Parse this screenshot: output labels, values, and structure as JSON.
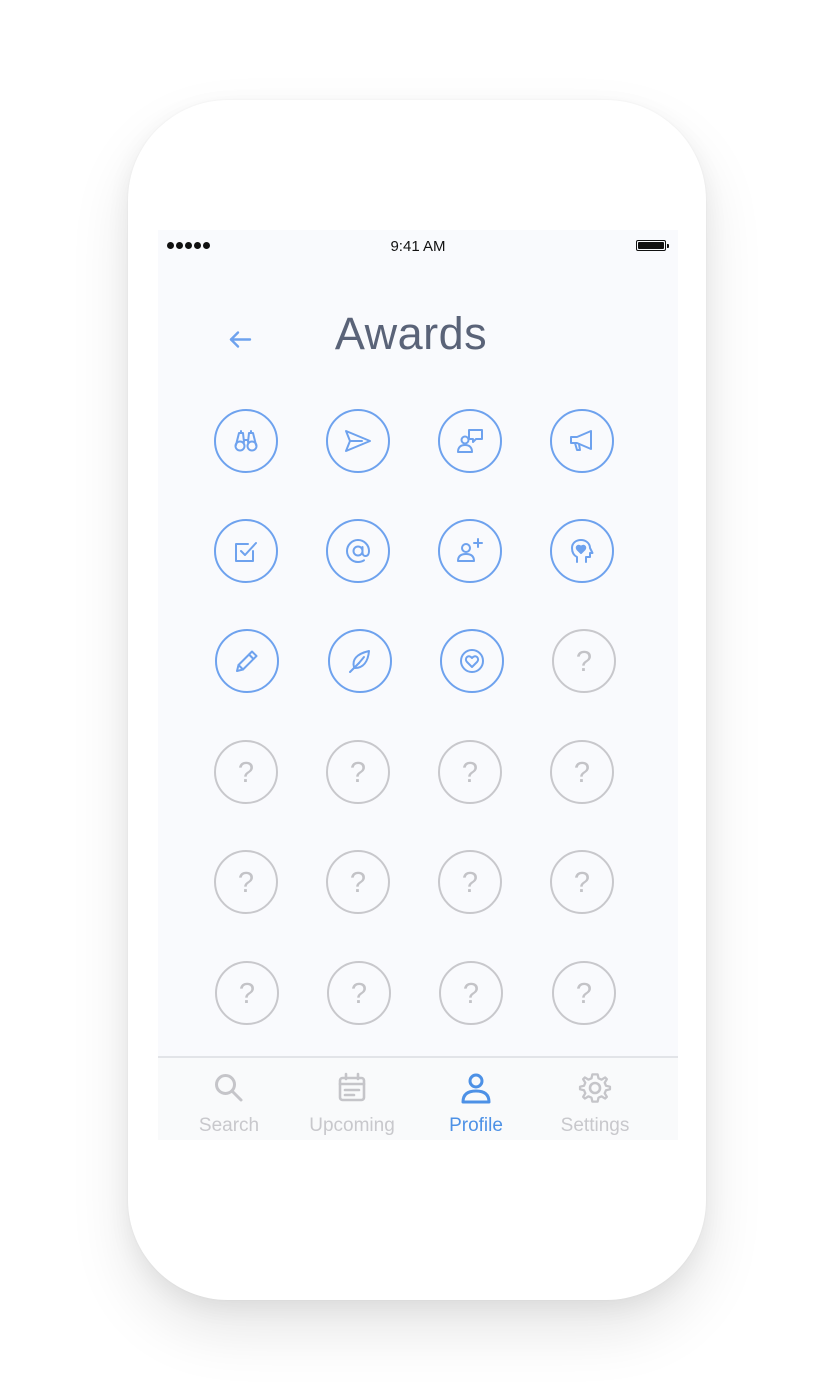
{
  "status_bar": {
    "time": "9:41 AM"
  },
  "header": {
    "title": "Awards",
    "back_icon": "arrow-left-icon"
  },
  "awards": {
    "unlocked": [
      {
        "icon": "binoculars-icon"
      },
      {
        "icon": "paper-plane-icon"
      },
      {
        "icon": "person-speech-icon"
      },
      {
        "icon": "megaphone-icon"
      },
      {
        "icon": "checkbox-icon"
      },
      {
        "icon": "at-sign-icon"
      },
      {
        "icon": "add-user-icon"
      },
      {
        "icon": "head-heart-icon"
      },
      {
        "icon": "pencil-icon"
      },
      {
        "icon": "feather-icon"
      },
      {
        "icon": "heart-circle-icon"
      }
    ],
    "locked_count_label": "?",
    "locked": [
      "?",
      "?",
      "?",
      "?",
      "?",
      "?",
      "?",
      "?",
      "?",
      "?",
      "?",
      "?",
      "?"
    ]
  },
  "tab_bar": {
    "tabs": [
      {
        "label": "Search",
        "icon": "search-icon",
        "active": false
      },
      {
        "label": "Upcoming",
        "icon": "calendar-icon",
        "active": false
      },
      {
        "label": "Profile",
        "icon": "person-icon",
        "active": true
      },
      {
        "label": "Settings",
        "icon": "gear-icon",
        "active": false
      }
    ]
  },
  "colors": {
    "accent": "#6ea2ee",
    "active_tab": "#4d91e6",
    "locked": "#c8c8cc",
    "title": "#5a6378",
    "screen_background": "#f9fafd"
  }
}
